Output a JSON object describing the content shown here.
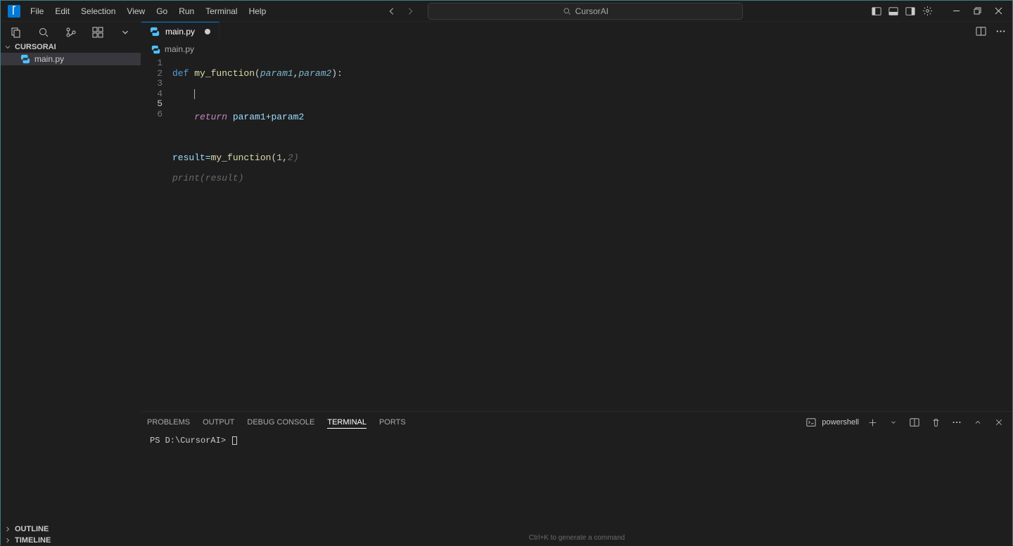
{
  "menu": {
    "file": "File",
    "edit": "Edit",
    "selection": "Selection",
    "view": "View",
    "go": "Go",
    "run": "Run",
    "terminal": "Terminal",
    "help": "Help"
  },
  "search_text": "CursorAI",
  "explorer": {
    "project_name": "CURSORAI",
    "files": [
      {
        "name": "main.py"
      }
    ]
  },
  "sidebar_sections": {
    "outline": "OUTLINE",
    "timeline": "TIMELINE"
  },
  "tab": {
    "filename": "main.py"
  },
  "breadcrumb": {
    "filename": "main.py"
  },
  "code": {
    "lines": [
      "1",
      "2",
      "3",
      "4",
      "5",
      "6"
    ],
    "l1": {
      "def": "def",
      "fn": "my_function",
      "p1": "param1",
      "p2": "param2",
      "end": "):"
    },
    "l3": {
      "ret": "return",
      "rest": " param1+param2"
    },
    "l5": {
      "a": "result=",
      "fn": "my_function",
      "p": "(",
      "n1": "1",
      "c": ",",
      "n2": "2",
      "q": ")"
    },
    "l6": "print(result)"
  },
  "panel": {
    "tabs": {
      "problems": "PROBLEMS",
      "output": "OUTPUT",
      "debug": "DEBUG CONSOLE",
      "terminal": "TERMINAL",
      "ports": "PORTS"
    },
    "shell_name": "powershell",
    "prompt": "PS D:\\CursorAI> ",
    "hint": "Ctrl+K to generate a command"
  }
}
